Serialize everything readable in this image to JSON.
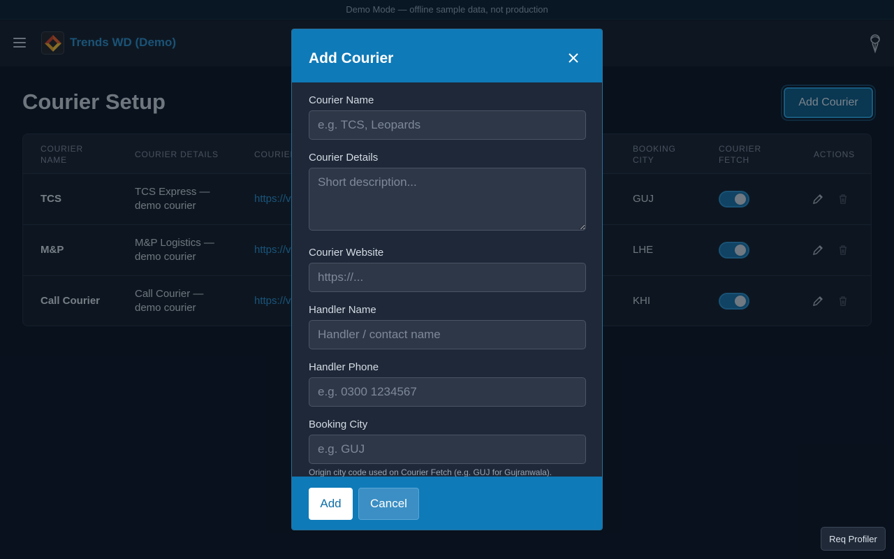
{
  "banner": {
    "text": "Demo Mode — offline sample data, not production"
  },
  "header": {
    "app_title": "Trends WD (Demo)",
    "menu_icon": "hamburger-menu-icon",
    "logo_icon": "app-logo",
    "profile_icon": "user-profile-icon"
  },
  "page": {
    "title": "Courier Setup",
    "add_button_label": "Add Courier"
  },
  "table": {
    "columns": [
      "COURIER",
      "NAME",
      "COURIER DETAILS",
      "COURIER",
      "BOOKING",
      "CITY",
      "COURIER",
      "FETCH",
      "ACTIONS"
    ],
    "rows": [
      {
        "name": "TCS",
        "details_line1": "TCS Express —",
        "details_line2": "demo courier",
        "website": "https://v",
        "booking_city": "GUJ",
        "fetch_enabled": true
      },
      {
        "name": "M&P",
        "details_line1": "M&P Logistics —",
        "details_line2": "demo courier",
        "website": "https://v",
        "booking_city": "LHE",
        "fetch_enabled": true
      },
      {
        "name": "Call Courier",
        "details_line1": "Call Courier —",
        "details_line2": "demo courier",
        "website": "https://v",
        "booking_city": "KHI",
        "fetch_enabled": true
      }
    ]
  },
  "modal": {
    "title": "Add Courier",
    "fields": {
      "courier_name": {
        "label": "Courier Name",
        "placeholder": "e.g. TCS, Leopards",
        "value": ""
      },
      "courier_details": {
        "label": "Courier Details",
        "placeholder": "Short description...",
        "value": ""
      },
      "courier_website": {
        "label": "Courier Website",
        "placeholder": "https://...",
        "value": ""
      },
      "handler_name": {
        "label": "Handler Name",
        "placeholder": "Handler / contact name",
        "value": ""
      },
      "handler_phone": {
        "label": "Handler Phone",
        "placeholder": "e.g. 0300 1234567",
        "value": ""
      },
      "booking_city": {
        "label": "Booking City",
        "placeholder": "e.g. GUJ",
        "value": "",
        "hint": "Origin city code used on Courier Fetch (e.g. GUJ for Gujranwala)."
      }
    },
    "add_label": "Add",
    "cancel_label": "Cancel"
  },
  "req_profiler": {
    "label": "Req Profiler"
  },
  "colors": {
    "accent": "#0f7ab8",
    "link": "#2b8fd0",
    "background": "#0b1626"
  }
}
